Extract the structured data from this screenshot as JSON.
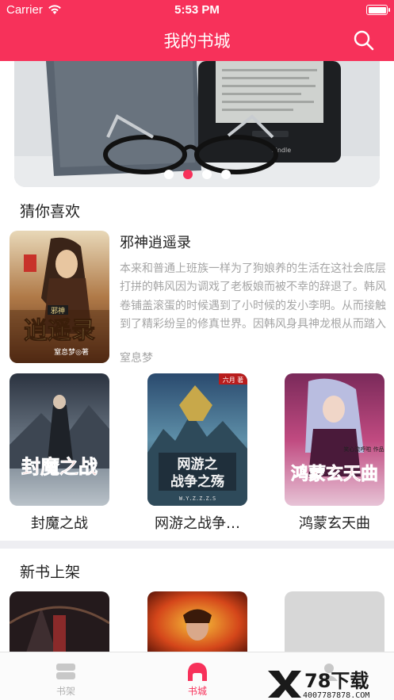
{
  "status_bar": {
    "carrier": "Carrier",
    "time": "5:53 PM"
  },
  "nav": {
    "title": "我的书城",
    "search_icon": "search-icon"
  },
  "banner": {
    "dots_count": 4,
    "active_index": 1
  },
  "guess": {
    "title": "猜你喜欢",
    "featured": {
      "title": "邪神逍遥录",
      "description": "本来和普通上班族一样为了狗娘养的生活在这社会底层打拼的韩风因为调戏了老板娘而被不幸的辞退了。韩风卷铺盖滚蛋的时候遇到了小时候的发小李明。从而接触到了精彩纷呈的修真世界。因韩风身具神龙根从而踏入了双修之途。从此...",
      "author": "窒息梦",
      "cover_text": {
        "badge": "邪神",
        "main": "逍遥录",
        "sub": "窒息梦◎著"
      }
    },
    "books": [
      {
        "name": "封魔之战",
        "cover_text": "封魔之战"
      },
      {
        "name": "网游之战争…",
        "cover_text": "网游之\n战争之殇",
        "cover_sub": "W.Y.Z.Z.Z.S",
        "corner": "六月 著"
      },
      {
        "name": "鸿蒙玄天曲",
        "cover_text": "鸿蒙玄天曲",
        "cover_sub": "笑心流呼啦 作品"
      }
    ]
  },
  "new_books": {
    "title": "新书上架"
  },
  "tabbar": {
    "items": [
      {
        "label": "书架",
        "icon": "bookshelf-icon",
        "active": false
      },
      {
        "label": "书城",
        "icon": "bookstore-icon",
        "active": true
      },
      {
        "label": "",
        "icon": "profile-icon",
        "active": false
      }
    ]
  },
  "watermark": {
    "brand": "78下载",
    "url": "4007787878.COM"
  },
  "colors": {
    "accent": "#f7315a",
    "muted_text": "#a5a5a5",
    "divider": "#eeeef2"
  }
}
